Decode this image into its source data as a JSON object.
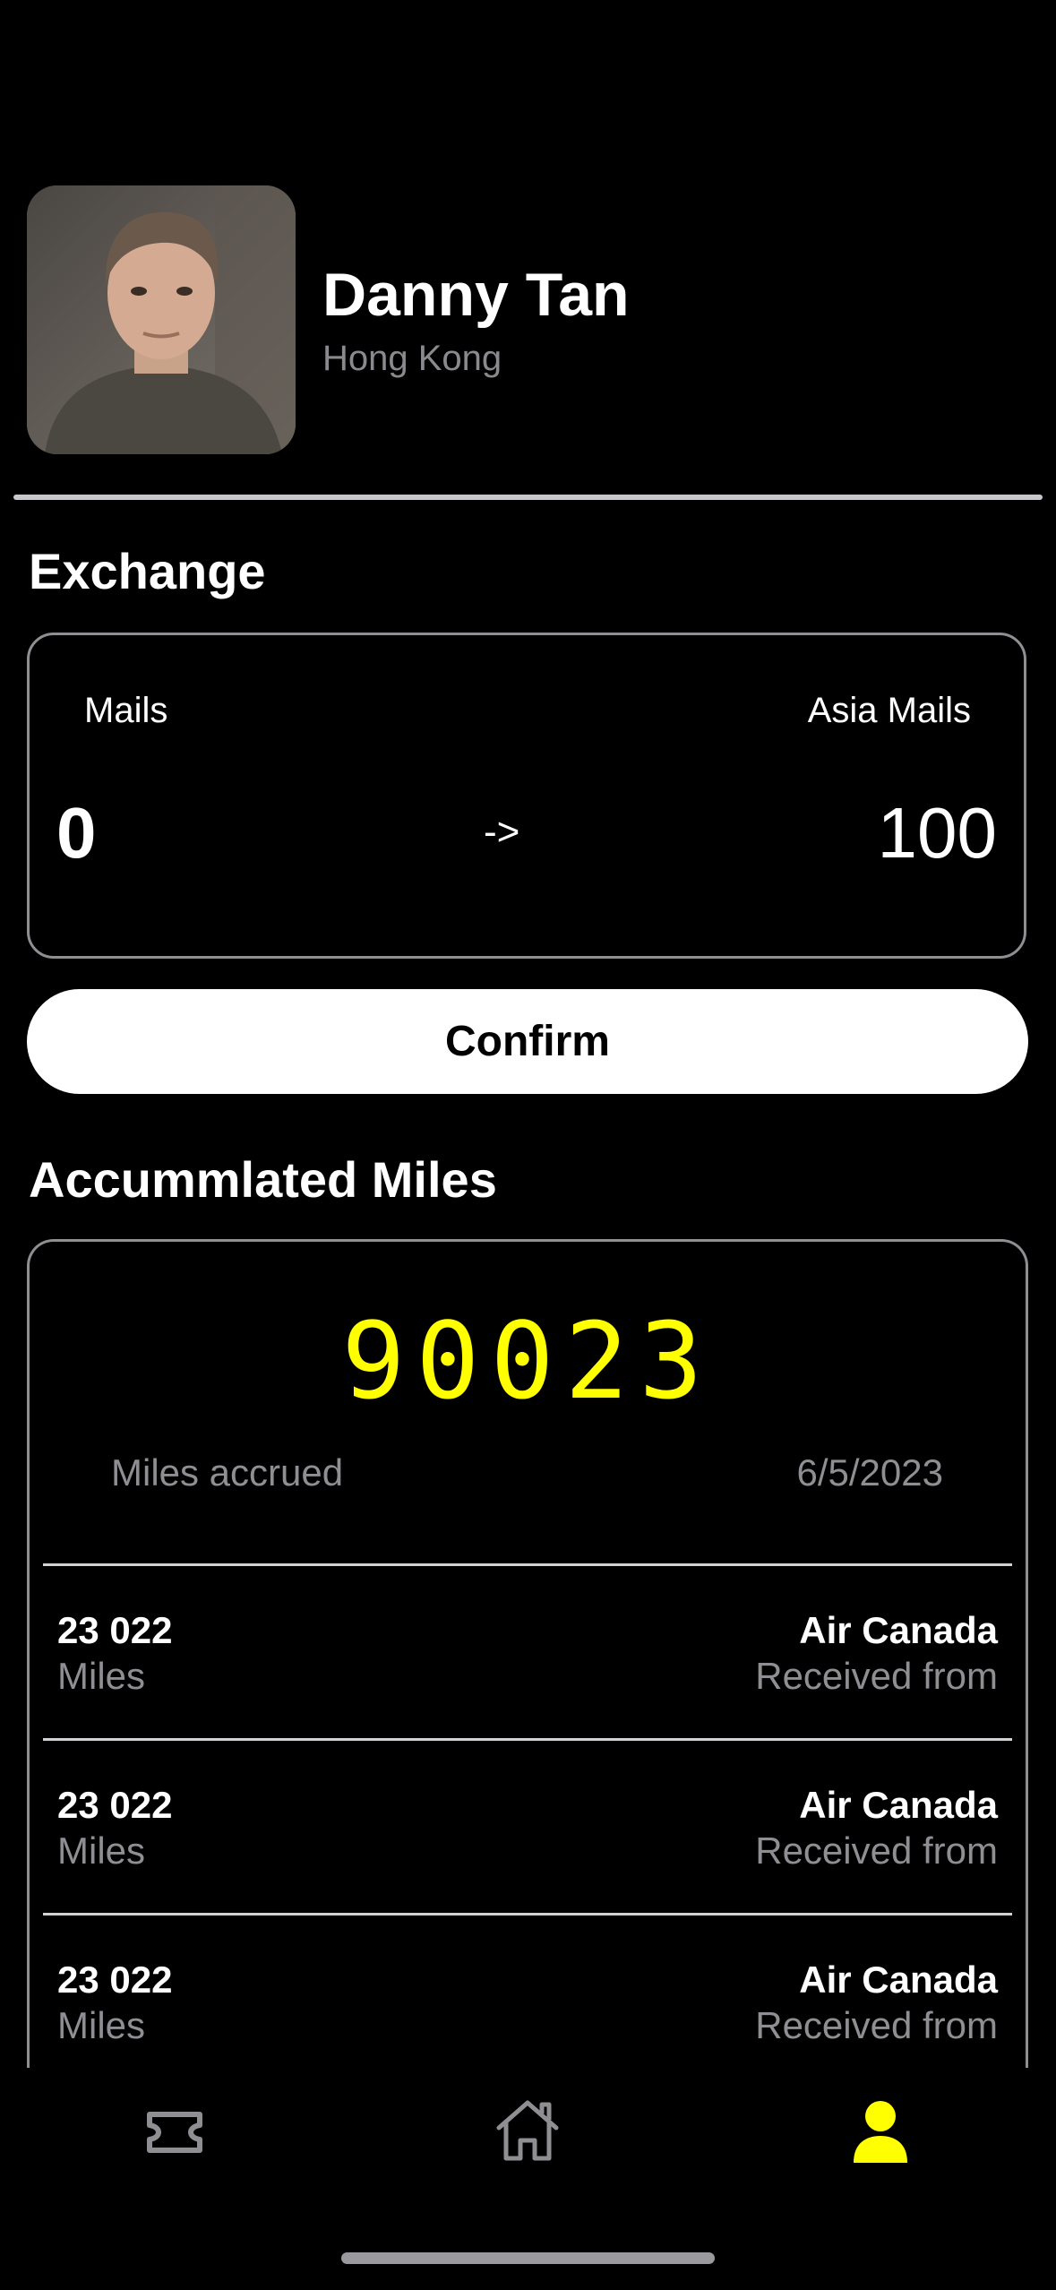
{
  "profile": {
    "name": "Danny Tan",
    "location": "Hong Kong",
    "avatar_icon": "person-photo"
  },
  "exchange": {
    "title": "Exchange",
    "from_label": "Mails",
    "to_label": "Asia Mails",
    "from_value": "0",
    "arrow": "->",
    "to_value": "100",
    "confirm_label": "Confirm"
  },
  "accumulated": {
    "title": "Accummlated Miles",
    "total": "90023",
    "total_caption": "Miles accrued",
    "date": "6/5/2023",
    "rows": [
      {
        "amount": "23 022",
        "unit": "Miles",
        "source": "Air Canada",
        "caption": "Received from"
      },
      {
        "amount": "23 022",
        "unit": "Miles",
        "source": "Air Canada",
        "caption": "Received from"
      },
      {
        "amount": "23 022",
        "unit": "Miles",
        "source": "Air Canada",
        "caption": "Received from"
      }
    ]
  },
  "tabbar": {
    "tabs": [
      {
        "icon": "ticket-icon",
        "active": false
      },
      {
        "icon": "home-icon",
        "active": false
      },
      {
        "icon": "person-icon",
        "active": true
      }
    ],
    "active_color": "#ffff00",
    "inactive_color": "#8e8e93"
  }
}
